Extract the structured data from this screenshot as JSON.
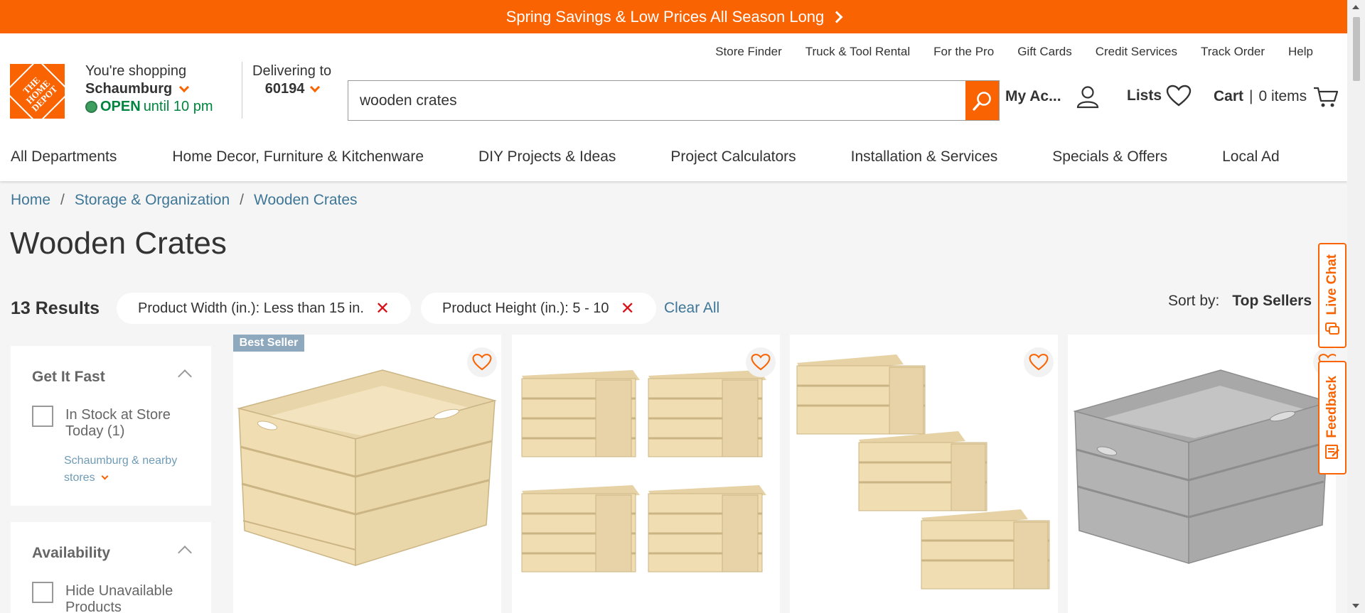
{
  "promo": {
    "text": "Spring Savings & Low Prices All Season Long"
  },
  "utility_links": [
    "Store Finder",
    "Truck & Tool Rental",
    "For the Pro",
    "Gift Cards",
    "Credit Services",
    "Track Order",
    "Help"
  ],
  "logo": {
    "text": "THE HOME DEPOT"
  },
  "store": {
    "shopping_label": "You're shopping",
    "name": "Schaumburg",
    "status": "OPEN",
    "hours": "until 10 pm"
  },
  "delivery": {
    "label": "Delivering to",
    "zip": "60194"
  },
  "search": {
    "value": "wooden crates"
  },
  "account": {
    "label": "My Ac..."
  },
  "lists": {
    "label": "Lists"
  },
  "cart": {
    "label": "Cart",
    "separator": "|",
    "count": "0 items"
  },
  "nav": [
    "All Departments",
    "Home Decor, Furniture & Kitchenware",
    "DIY Projects & Ideas",
    "Project Calculators",
    "Installation & Services",
    "Specials & Offers",
    "Local Ad"
  ],
  "breadcrumb": [
    "Home",
    "Storage & Organization",
    "Wooden Crates"
  ],
  "breadcrumb_sep": "/",
  "page_title": "Wooden Crates",
  "results": {
    "count": "13 Results"
  },
  "filters": [
    {
      "label": "Product Width (in.): Less than 15 in."
    },
    {
      "label": "Product Height (in.): 5 - 10"
    }
  ],
  "filter_remove": "✕",
  "clear_all": "Clear All",
  "sort": {
    "label": "Sort by:",
    "value": "Top Sellers"
  },
  "refine": {
    "get_it_fast": {
      "title": "Get It Fast",
      "option": "In Stock at Store Today (1)",
      "location": "Schaumburg & nearby stores"
    },
    "availability": {
      "title": "Availability",
      "option": "Hide Unavailable Products"
    }
  },
  "products": [
    {
      "badge": "Best Seller",
      "image": "single-natural-crate"
    },
    {
      "image": "four-natural-crates"
    },
    {
      "image": "three-natural-crates"
    },
    {
      "image": "single-gray-crate"
    }
  ],
  "side_tabs": {
    "live_chat": "Live Chat",
    "feedback": "Feedback"
  },
  "colors": {
    "brand": "#f96302",
    "link": "#3e7697",
    "open": "#00853e",
    "remove": "#d81118"
  }
}
